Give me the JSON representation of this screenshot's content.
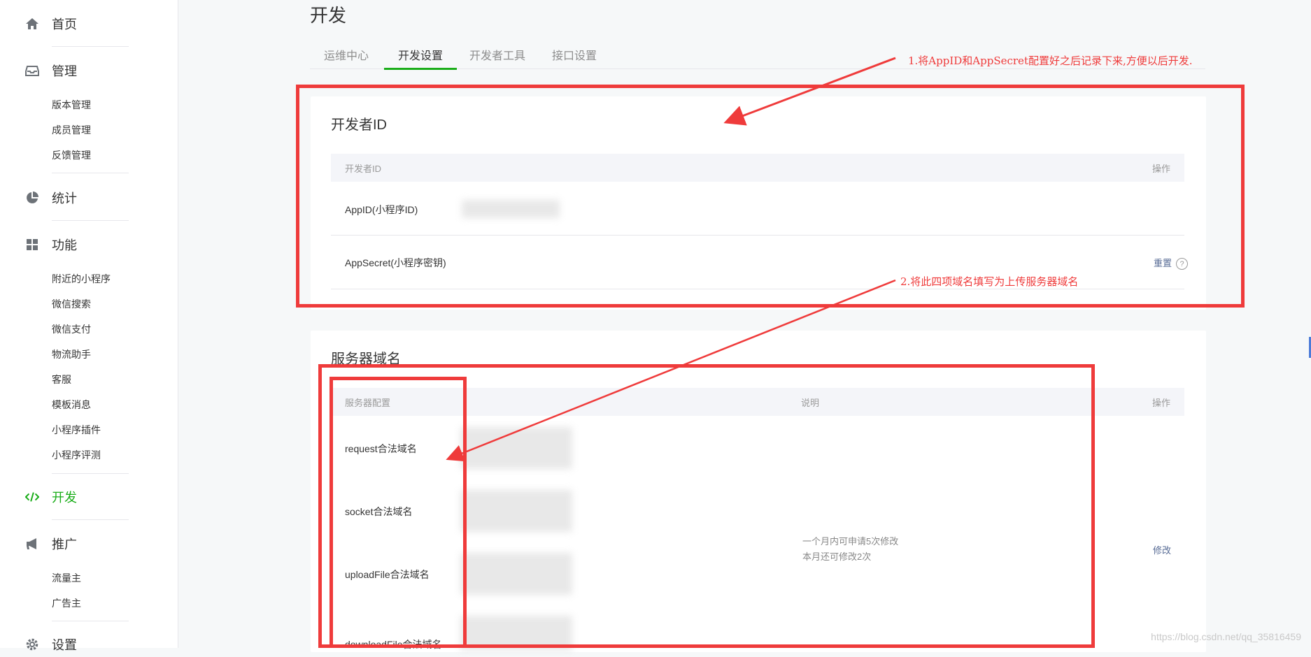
{
  "sidebar": {
    "home": "首页",
    "manage": "管理",
    "manage_items": [
      "版本管理",
      "成员管理",
      "反馈管理"
    ],
    "stats": "统计",
    "features": "功能",
    "feature_items": [
      "附近的小程序",
      "微信搜索",
      "微信支付",
      "物流助手",
      "客服",
      "模板消息",
      "小程序插件",
      "小程序评测"
    ],
    "dev": "开发",
    "promo": "推广",
    "promo_items": [
      "流量主",
      "广告主"
    ],
    "settings": "设置"
  },
  "page_title": "开发",
  "tabs": [
    "运维中心",
    "开发设置",
    "开发者工具",
    "接口设置"
  ],
  "dev_id": {
    "title": "开发者ID",
    "col_name": "开发者ID",
    "col_action": "操作",
    "appid_label": "AppID(小程序ID)",
    "secret_label": "AppSecret(小程序密钥)",
    "reset": "重置",
    "help": "?"
  },
  "server": {
    "title": "服务器域名",
    "col_config": "服务器配置",
    "col_desc": "说明",
    "col_action": "操作",
    "rows": [
      "request合法域名",
      "socket合法域名",
      "uploadFile合法域名",
      "downloadFile合法域名"
    ],
    "desc_line1": "一个月内可申请5次修改",
    "desc_line2": "本月还可修改2次",
    "modify": "修改"
  },
  "annotations": {
    "note1": "1.将AppID和AppSecret配置好之后记录下来,方便以后开发.",
    "note2": "2.将此四项域名填写为上传服务器域名"
  },
  "watermark": "https://blog.csdn.net/qq_35816459",
  "colors": {
    "accent": "#1aad19",
    "annotation": "#ef3b3b",
    "link": "#576b95"
  }
}
